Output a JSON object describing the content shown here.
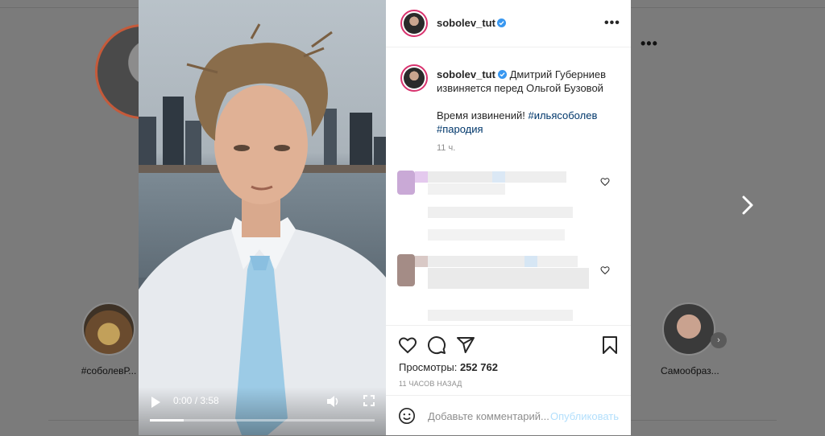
{
  "background": {
    "highlights": [
      {
        "label": "#соболевР..."
      },
      {
        "label": "Самообраз..."
      }
    ],
    "more_icon": "more-horizontal-icon",
    "next_icon": "chevron-right-icon"
  },
  "video": {
    "time": "0:00 / 3:58",
    "progress": 0.15,
    "icons": [
      "play-icon",
      "volume-icon",
      "fullscreen-icon"
    ]
  },
  "post": {
    "username": "sobolev_tut",
    "verified": true,
    "caption_line1": "Дмитрий Губерниев извиняется перед Ольгой Бузовой",
    "caption_line2": "Время извинений!",
    "hashtags": [
      "#ильясоболев",
      "#пародия"
    ],
    "time_ago": "11 ч.",
    "views_label": "Просмотры:",
    "views_count": "252 762",
    "date": "11 ЧАСОВ НАЗАД",
    "comment_placeholder": "Добавьте комментарий...",
    "post_label": "Опубликовать"
  },
  "colors": {
    "accent_blue": "#0095f6",
    "verified_blue": "#3897f0",
    "post_disabled": "#b2dffc",
    "hashtag": "#00376b",
    "story_ring": "#d8326e"
  }
}
